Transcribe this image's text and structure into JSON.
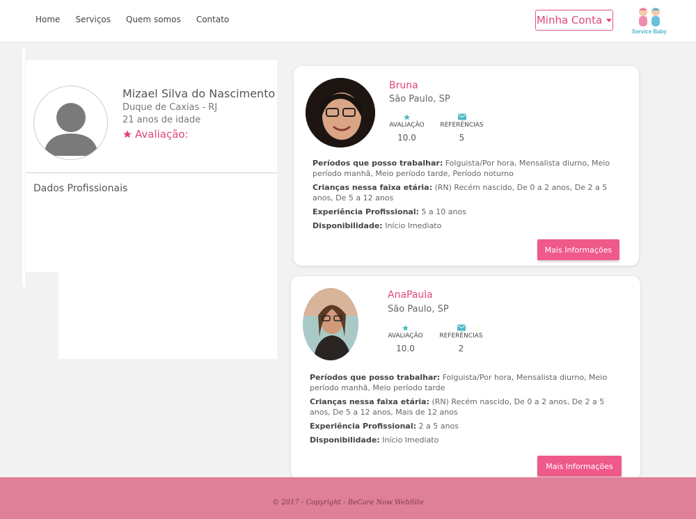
{
  "nav": {
    "links": [
      "Home",
      "Serviços",
      "Quem somos",
      "Contato"
    ],
    "account_label": "Minha Conta",
    "logo_text": "Service Baby"
  },
  "profile": {
    "name": "Mizael Silva do Nascimento",
    "city": "Duque de Caxias - RJ",
    "age": "21 anos de idade",
    "rating_label": "Avaliação:",
    "section_title": "Dados Profissionais"
  },
  "candidates": [
    {
      "name": "Bruna",
      "city": "São Paulo, SP",
      "rating_label": "AVALIAÇÃO",
      "rating_value": "10.0",
      "refs_label": "REFERÊNCIAS",
      "refs_value": "5",
      "periods_label": "Períodos que posso trabalhar:",
      "periods_value": "Folguista/Por hora, Mensalista diurno, Meio período manhã, Meio período tarde, Período noturno",
      "ages_label": "Crianças nessa faixa etária:",
      "ages_value": "(RN) Recém nascido, De 0 a 2 anos, De 2 a 5 anos, De 5 a 12 anos",
      "exp_label": "Experiência Profissional:",
      "exp_value": "5 a 10 anos",
      "avail_label": "Disponibilidade:",
      "avail_value": "Início Imediato",
      "button": "Mais Informações"
    },
    {
      "name": "AnaPaula",
      "city": "São Paulo, SP",
      "rating_label": "AVALIAÇÃO",
      "rating_value": "10.0",
      "refs_label": "REFERÊNCIAS",
      "refs_value": "2",
      "periods_label": "Períodos que posso trabalhar:",
      "periods_value": "Folguista/Por hora, Mensalista diurno, Meio período manhã, Meio período tarde",
      "ages_label": "Crianças nessa faixa etária:",
      "ages_value": "(RN) Recém nascido, De 0 a 2 anos, De 2 a 5 anos, De 5 a 12 anos, Mais de 12 anos",
      "exp_label": "Experiência Profissional:",
      "exp_value": "2 a 5 anos",
      "avail_label": "Disponibilidade:",
      "avail_value": "Início Imediato",
      "button": "Mais Informações"
    }
  ],
  "footer": {
    "text": "© 2017 - Copyright - BeCare Now WebSite"
  },
  "colors": {
    "accent": "#e0457a",
    "button": "#ef5a8a",
    "footer": "#e07f99",
    "icon": "#4fb8c8"
  }
}
